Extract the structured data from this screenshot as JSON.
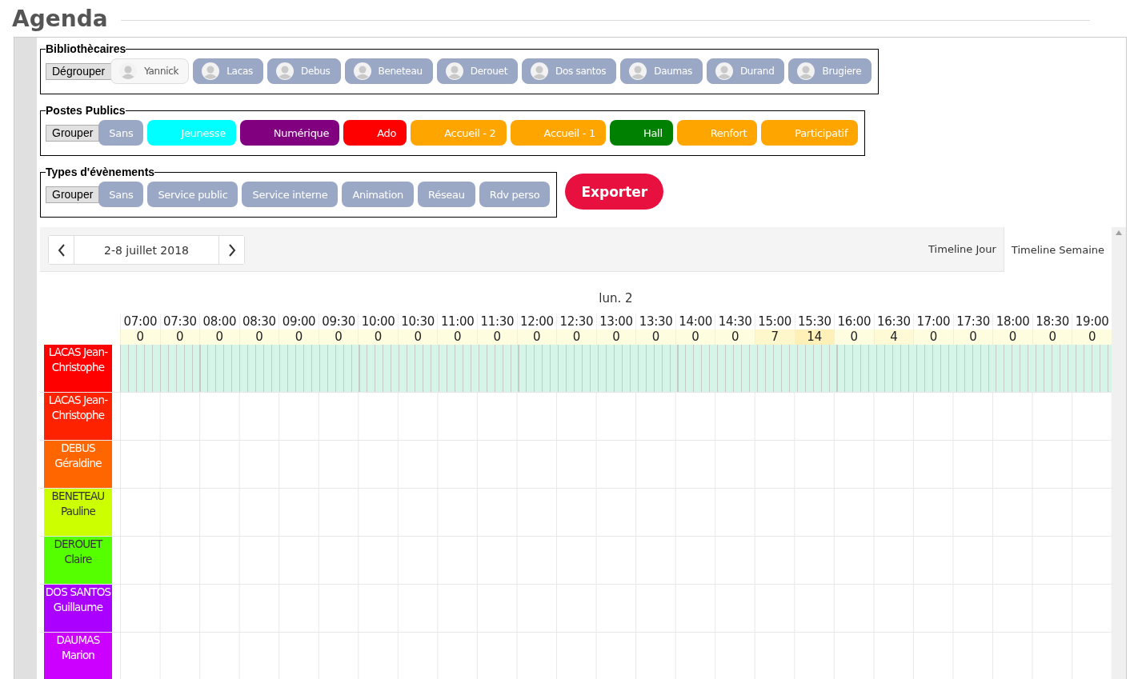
{
  "title": "Agenda",
  "librarians": {
    "legend": "Bibliothècaires",
    "toggle": "Dégrouper",
    "items": [
      {
        "name": "Yannick",
        "selected": false
      },
      {
        "name": "Lacas",
        "selected": true
      },
      {
        "name": "Debus",
        "selected": true
      },
      {
        "name": "Beneteau",
        "selected": true
      },
      {
        "name": "Derouet",
        "selected": true
      },
      {
        "name": "Dos santos",
        "selected": true
      },
      {
        "name": "Daumas",
        "selected": true
      },
      {
        "name": "Durand",
        "selected": true
      },
      {
        "name": "Brugiere",
        "selected": true
      }
    ]
  },
  "posts": {
    "legend": "Postes Publics",
    "toggle": "Grouper",
    "items": [
      {
        "label": "Sans",
        "color": "#9aa8c6"
      },
      {
        "label": "Jeunesse",
        "color": "#00ffff"
      },
      {
        "label": "Numérique",
        "color": "#800080"
      },
      {
        "label": "Ado",
        "color": "#ff0000"
      },
      {
        "label": "Accueil - 2",
        "color": "#ffa500"
      },
      {
        "label": "Accueil - 1",
        "color": "#ffa500"
      },
      {
        "label": "Hall",
        "color": "#008000"
      },
      {
        "label": "Renfort",
        "color": "#ffa500"
      },
      {
        "label": "Participatif",
        "color": "#ffa500"
      }
    ]
  },
  "event_types": {
    "legend": "Types d'évènements",
    "toggle": "Grouper",
    "items": [
      "Sans",
      "Service public",
      "Service interne",
      "Animation",
      "Réseau",
      "Rdv perso"
    ]
  },
  "export_button": "Exporter",
  "calendar": {
    "range": "2-8 juillet 2018",
    "views": [
      {
        "label": "Timeline Jour",
        "selected": false
      },
      {
        "label": "Timeline Semaine",
        "selected": true
      }
    ],
    "day": "lun. 2",
    "slots": [
      {
        "time": "07:00",
        "count": "0"
      },
      {
        "time": "07:30",
        "count": "0"
      },
      {
        "time": "08:00",
        "count": "0"
      },
      {
        "time": "08:30",
        "count": "0"
      },
      {
        "time": "09:00",
        "count": "0"
      },
      {
        "time": "09:30",
        "count": "0"
      },
      {
        "time": "10:00",
        "count": "0"
      },
      {
        "time": "10:30",
        "count": "0"
      },
      {
        "time": "11:00",
        "count": "0"
      },
      {
        "time": "11:30",
        "count": "0"
      },
      {
        "time": "12:00",
        "count": "0"
      },
      {
        "time": "12:30",
        "count": "0"
      },
      {
        "time": "13:00",
        "count": "0"
      },
      {
        "time": "13:30",
        "count": "0"
      },
      {
        "time": "14:00",
        "count": "0"
      },
      {
        "time": "14:30",
        "count": "0"
      },
      {
        "time": "15:00",
        "count": "7"
      },
      {
        "time": "15:30",
        "count": "14"
      },
      {
        "time": "16:00",
        "count": "0"
      },
      {
        "time": "16:30",
        "count": "4"
      },
      {
        "time": "17:00",
        "count": "0"
      },
      {
        "time": "17:30",
        "count": "0"
      },
      {
        "time": "18:00",
        "count": "0"
      },
      {
        "time": "18:30",
        "count": "0"
      },
      {
        "time": "19:00",
        "count": "0"
      }
    ],
    "resources": [
      {
        "name": "LACAS Jean-Christophe",
        "color": "#ff0000",
        "highlighted": true
      },
      {
        "name": "LACAS Jean-Christophe",
        "color": "#ff2200",
        "highlighted": false
      },
      {
        "name": "DEBUS Géraldine",
        "color": "#ff6600",
        "highlighted": false
      },
      {
        "name": "BENETEAU Pauline",
        "color": "#ccff00",
        "highlighted": false
      },
      {
        "name": "DEROUET Claire",
        "color": "#55ff00",
        "highlighted": false
      },
      {
        "name": "DOS SANTOS Guillaume",
        "color": "#aa00ff",
        "highlighted": false
      },
      {
        "name": "DAUMAS Marion",
        "color": "#cc00ff",
        "highlighted": false
      }
    ]
  }
}
